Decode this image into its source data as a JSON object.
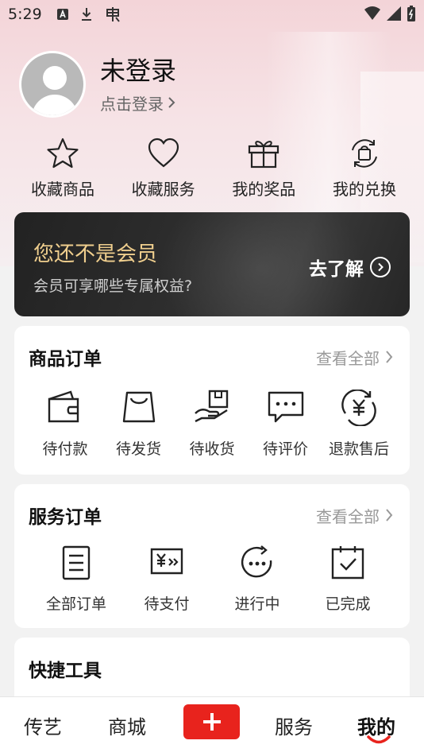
{
  "status_bar": {
    "time": "5:29",
    "icons": [
      "notification-a-icon",
      "download-icon",
      "bug-icon"
    ],
    "right_icons": [
      "wifi-icon",
      "signal-icon",
      "battery-icon"
    ]
  },
  "profile": {
    "name": "未登录",
    "login_link": "点击登录",
    "avatar_icon": "default-avatar-icon"
  },
  "favorites": [
    {
      "label": "收藏商品",
      "icon": "star-icon"
    },
    {
      "label": "收藏服务",
      "icon": "heart-icon"
    },
    {
      "label": "我的奖品",
      "icon": "gift-icon"
    },
    {
      "label": "我的兑换",
      "icon": "exchange-bag-icon"
    }
  ],
  "member": {
    "title": "您还不是会员",
    "subtitle": "会员可享哪些专属权益?",
    "cta": "去了解",
    "title_color": "#f0cf8e"
  },
  "goods_orders": {
    "title": "商品订单",
    "view_all": "查看全部",
    "items": [
      {
        "label": "待付款",
        "icon": "wallet-icon"
      },
      {
        "label": "待发货",
        "icon": "package-icon"
      },
      {
        "label": "待收货",
        "icon": "hand-box-icon"
      },
      {
        "label": "待评价",
        "icon": "comment-icon"
      },
      {
        "label": "退款售后",
        "icon": "refund-yen-icon"
      }
    ]
  },
  "service_orders": {
    "title": "服务订单",
    "view_all": "查看全部",
    "items": [
      {
        "label": "全部订单",
        "icon": "list-document-icon"
      },
      {
        "label": "待支付",
        "icon": "pay-yen-icon"
      },
      {
        "label": "进行中",
        "icon": "in-progress-icon"
      },
      {
        "label": "已完成",
        "icon": "check-calendar-icon"
      }
    ]
  },
  "quick_tools": {
    "title": "快捷工具"
  },
  "tabbar": {
    "tabs": [
      {
        "label": "传艺",
        "active": false
      },
      {
        "label": "商城",
        "active": false
      },
      {
        "label": "服务",
        "active": false
      },
      {
        "label": "我的",
        "active": true
      }
    ],
    "add_icon": "plus-icon",
    "accent": "#e8231d"
  }
}
